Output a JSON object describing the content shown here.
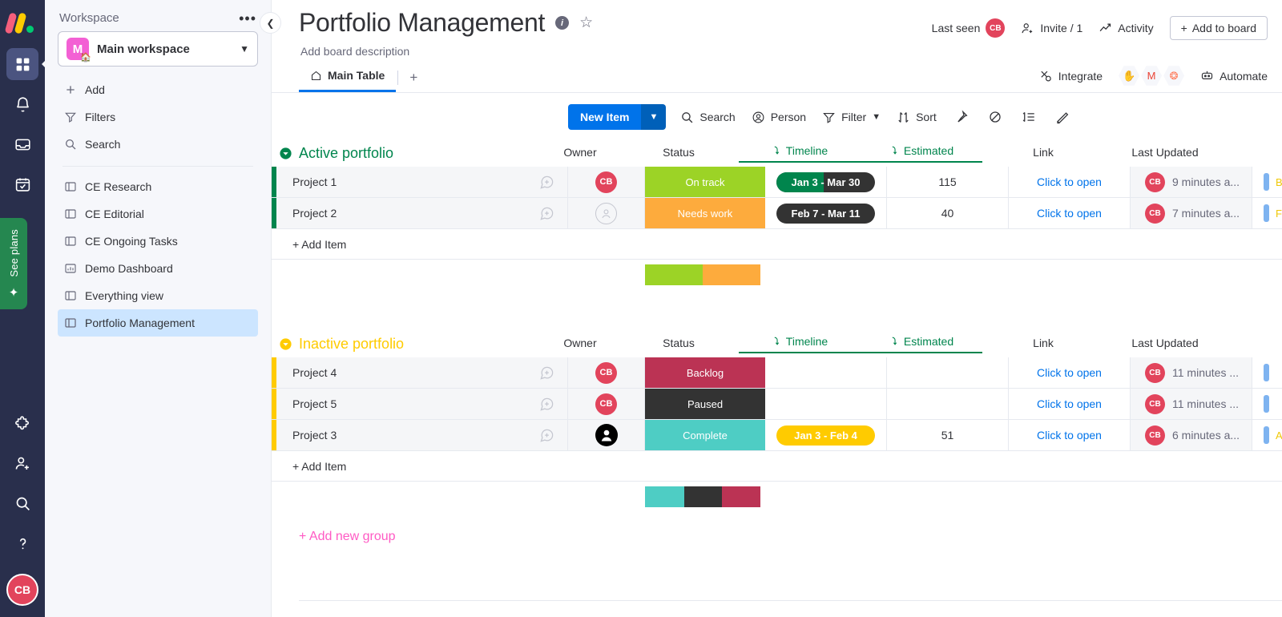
{
  "rail": {
    "logo_name": "monday-logo",
    "items": [
      {
        "name": "home-grid-icon",
        "active": true
      },
      {
        "name": "notifications-bell-icon",
        "active": false
      },
      {
        "name": "inbox-icon",
        "active": false
      },
      {
        "name": "my-work-calendar-icon",
        "active": false
      }
    ],
    "bottom_items": [
      {
        "name": "apps-puzzle-icon"
      },
      {
        "name": "invite-member-icon"
      },
      {
        "name": "search-icon"
      },
      {
        "name": "help-icon"
      }
    ],
    "see_plans_label": "See plans",
    "user_initials": "CB"
  },
  "sidebar": {
    "header_title": "Workspace",
    "more_label": "•••",
    "workspace_initial": "M",
    "workspace_name": "Main workspace",
    "actions": [
      {
        "label": "Add",
        "icon": "plus-icon"
      },
      {
        "label": "Filters",
        "icon": "filter-icon"
      },
      {
        "label": "Search",
        "icon": "search-icon"
      }
    ],
    "items": [
      {
        "label": "CE Research",
        "icon": "board-icon",
        "selected": false
      },
      {
        "label": "CE Editorial",
        "icon": "board-icon",
        "selected": false
      },
      {
        "label": "CE Ongoing Tasks",
        "icon": "board-icon",
        "selected": false
      },
      {
        "label": "Demo Dashboard",
        "icon": "dashboard-icon",
        "selected": false
      },
      {
        "label": "Everything view",
        "icon": "board-icon",
        "selected": false
      },
      {
        "label": "Portfolio Management",
        "icon": "board-icon",
        "selected": true
      }
    ]
  },
  "header": {
    "title": "Portfolio Management",
    "description_placeholder": "Add board description",
    "last_seen_label": "Last seen",
    "last_seen_initials": "CB",
    "invite_label": "Invite / 1",
    "activity_label": "Activity",
    "add_to_board_label": "Add to board",
    "add_to_board_plus": "+"
  },
  "tabs": {
    "items": [
      {
        "label": "Main Table",
        "icon": "home-icon",
        "active": true
      }
    ],
    "add_label": "+",
    "integrate_label": "Integrate",
    "integration_icons": [
      "mailchimp-icon",
      "gmail-icon",
      "hubspot-icon"
    ],
    "automate_label": "Automate"
  },
  "toolbar": {
    "new_item_label": "New Item",
    "search_label": "Search",
    "person_label": "Person",
    "filter_label": "Filter",
    "sort_label": "Sort",
    "icon_buttons": [
      "pin-icon",
      "hide-eye-icon",
      "row-height-icon",
      "collapse-icon"
    ]
  },
  "columns": [
    {
      "key": "owner",
      "label": "Owner",
      "mirror": false
    },
    {
      "key": "status",
      "label": "Status",
      "mirror": false
    },
    {
      "key": "timeline",
      "label": "Timeline",
      "mirror": true
    },
    {
      "key": "estimated",
      "label": "Estimated",
      "mirror": true
    },
    {
      "key": "link",
      "label": "Link",
      "mirror": false
    },
    {
      "key": "last_updated",
      "label": "Last Updated",
      "mirror": false
    }
  ],
  "groups": [
    {
      "title": "Active portfolio",
      "color": "#00854d",
      "add_item_label": "+ Add Item",
      "rows": [
        {
          "name": "Project 1",
          "owner_initials": "CB",
          "owner_type": "initials",
          "status": "On track",
          "status_color": "#9cd326",
          "status_selected": false,
          "timeline": "Jan 3 - Mar 30",
          "timeline_bg": "#333333",
          "timeline_fill": "#00854d",
          "timeline_fill_pct": 48,
          "estimated": "115",
          "link": "Click to open",
          "updated_initials": "CB",
          "updated_text": "9 minutes a...",
          "extra_text": "B"
        },
        {
          "name": "Project 2",
          "owner_initials": "",
          "owner_type": "empty",
          "status": "Needs work",
          "status_color": "#fdab3d",
          "status_selected": false,
          "timeline": "Feb 7 - Mar 11",
          "timeline_bg": "#333333",
          "timeline_fill": "#333333",
          "timeline_fill_pct": 0,
          "estimated": "40",
          "link": "Click to open",
          "updated_initials": "CB",
          "updated_text": "7 minutes a...",
          "extra_text": "F"
        }
      ],
      "summary": [
        {
          "color": "#9cd326",
          "pct": 50
        },
        {
          "color": "#fdab3d",
          "pct": 50
        }
      ]
    },
    {
      "title": "Inactive portfolio",
      "color": "#ffcb00",
      "add_item_label": "+ Add Item",
      "rows": [
        {
          "name": "Project 4",
          "owner_initials": "CB",
          "owner_type": "initials",
          "status": "Backlog",
          "status_color": "#bb3354",
          "status_selected": false,
          "timeline": "",
          "timeline_bg": "",
          "timeline_fill": "",
          "timeline_fill_pct": 0,
          "estimated": "",
          "link": "Click to open",
          "updated_initials": "CB",
          "updated_text": "11 minutes ...",
          "extra_text": ""
        },
        {
          "name": "Project 5",
          "owner_initials": "CB",
          "owner_type": "initials",
          "status": "Paused",
          "status_color": "#333333",
          "status_selected": true,
          "timeline": "",
          "timeline_bg": "",
          "timeline_fill": "",
          "timeline_fill_pct": 0,
          "estimated": "",
          "link": "Click to open",
          "updated_initials": "CB",
          "updated_text": "11 minutes ...",
          "extra_text": ""
        },
        {
          "name": "Project 3",
          "owner_initials": "",
          "owner_type": "photo",
          "status": "Complete",
          "status_color": "#4ecdc4",
          "status_selected": false,
          "timeline": "Jan 3 - Feb 4",
          "timeline_bg": "#ffcb00",
          "timeline_fill": "#ffcb00",
          "timeline_fill_pct": 0,
          "estimated": "51",
          "link": "Click to open",
          "updated_initials": "CB",
          "updated_text": "6 minutes a...",
          "extra_text": "A"
        }
      ],
      "summary": [
        {
          "color": "#4ecdc4",
          "pct": 34
        },
        {
          "color": "#333333",
          "pct": 33
        },
        {
          "color": "#bb3354",
          "pct": 33
        }
      ]
    }
  ],
  "add_new_group_label": "+ Add new group"
}
